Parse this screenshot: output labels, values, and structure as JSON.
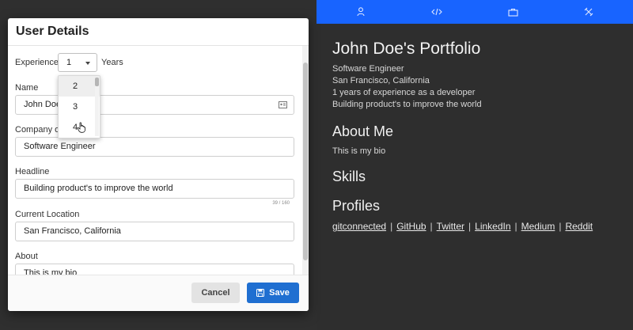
{
  "modal": {
    "title": "User Details",
    "experience": {
      "label": "Experience",
      "value": "1",
      "suffix": "Years",
      "options_visible": [
        "2",
        "3",
        "4"
      ],
      "highlighted": "2"
    },
    "fields": {
      "name": {
        "label": "Name",
        "value": "John Doe"
      },
      "company": {
        "label": "Company or",
        "value": "Software Engineer"
      },
      "headline": {
        "label": "Headline",
        "value": "Building product's to improve the world",
        "counter": "39 / 160"
      },
      "location": {
        "label": "Current Location",
        "value": "San Francisco, California"
      },
      "about": {
        "label": "About",
        "value": "This is my bio"
      }
    },
    "buttons": {
      "cancel": "Cancel",
      "save": "Save"
    }
  },
  "preview": {
    "nav_icons": [
      "user-icon",
      "code-icon",
      "briefcase-icon",
      "tools-icon"
    ],
    "name": "John Doe's Portfolio",
    "role": "Software Engineer",
    "location": "San Francisco, California",
    "experience": "1 years of experience as a developer",
    "headline": "Building product's to improve the world",
    "about_heading": "About Me",
    "bio": "This is my bio",
    "skills_heading": "Skills",
    "profiles_heading": "Profiles",
    "profiles": [
      "gitconnected",
      "GitHub",
      "Twitter",
      "LinkedIn",
      "Medium",
      "Reddit"
    ]
  },
  "colors": {
    "accent": "#1864ff",
    "save_button": "#1f6fd1"
  }
}
